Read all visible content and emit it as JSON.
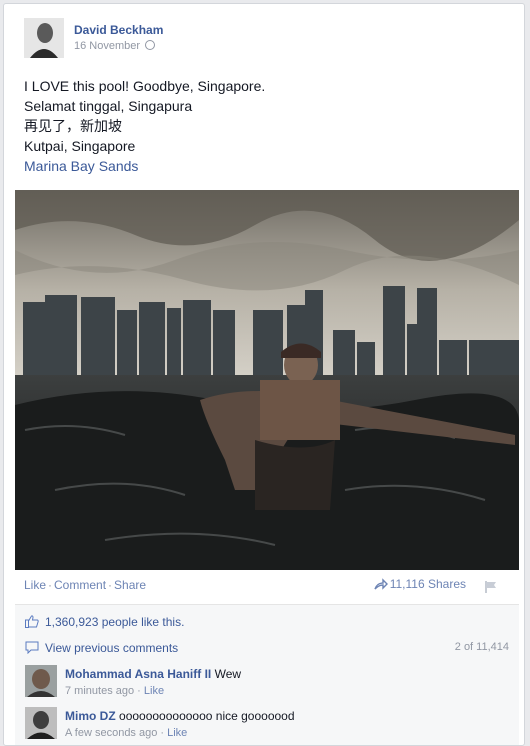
{
  "post": {
    "author": "David Beckham",
    "date": "16 November",
    "lines": [
      "I LOVE this pool! Goodbye, Singapore.",
      "Selamat tinggal, Singapura",
      "再见了，新加坡",
      "Kutpai, Singapore"
    ],
    "place": "Marina Bay Sands"
  },
  "actions": {
    "like": "Like",
    "comment": "Comment",
    "share": "Share",
    "shares_count": "11,116 Shares"
  },
  "ufi": {
    "likes_text": "1,360,923 people like this.",
    "view_previous": "View previous comments",
    "comment_count": "2 of 11,414"
  },
  "comments": [
    {
      "name": "Mohammad Asna Haniff II",
      "text": "Wew",
      "time": "7 minutes ago",
      "like": "Like"
    },
    {
      "name": "Mimo DZ",
      "text": "oooooooooooooo nice gooooood",
      "time": "A few seconds ago",
      "like": "Like"
    }
  ],
  "colors": {
    "link": "#3b5998",
    "muted": "#9197a3",
    "action": "#6d84b4"
  }
}
